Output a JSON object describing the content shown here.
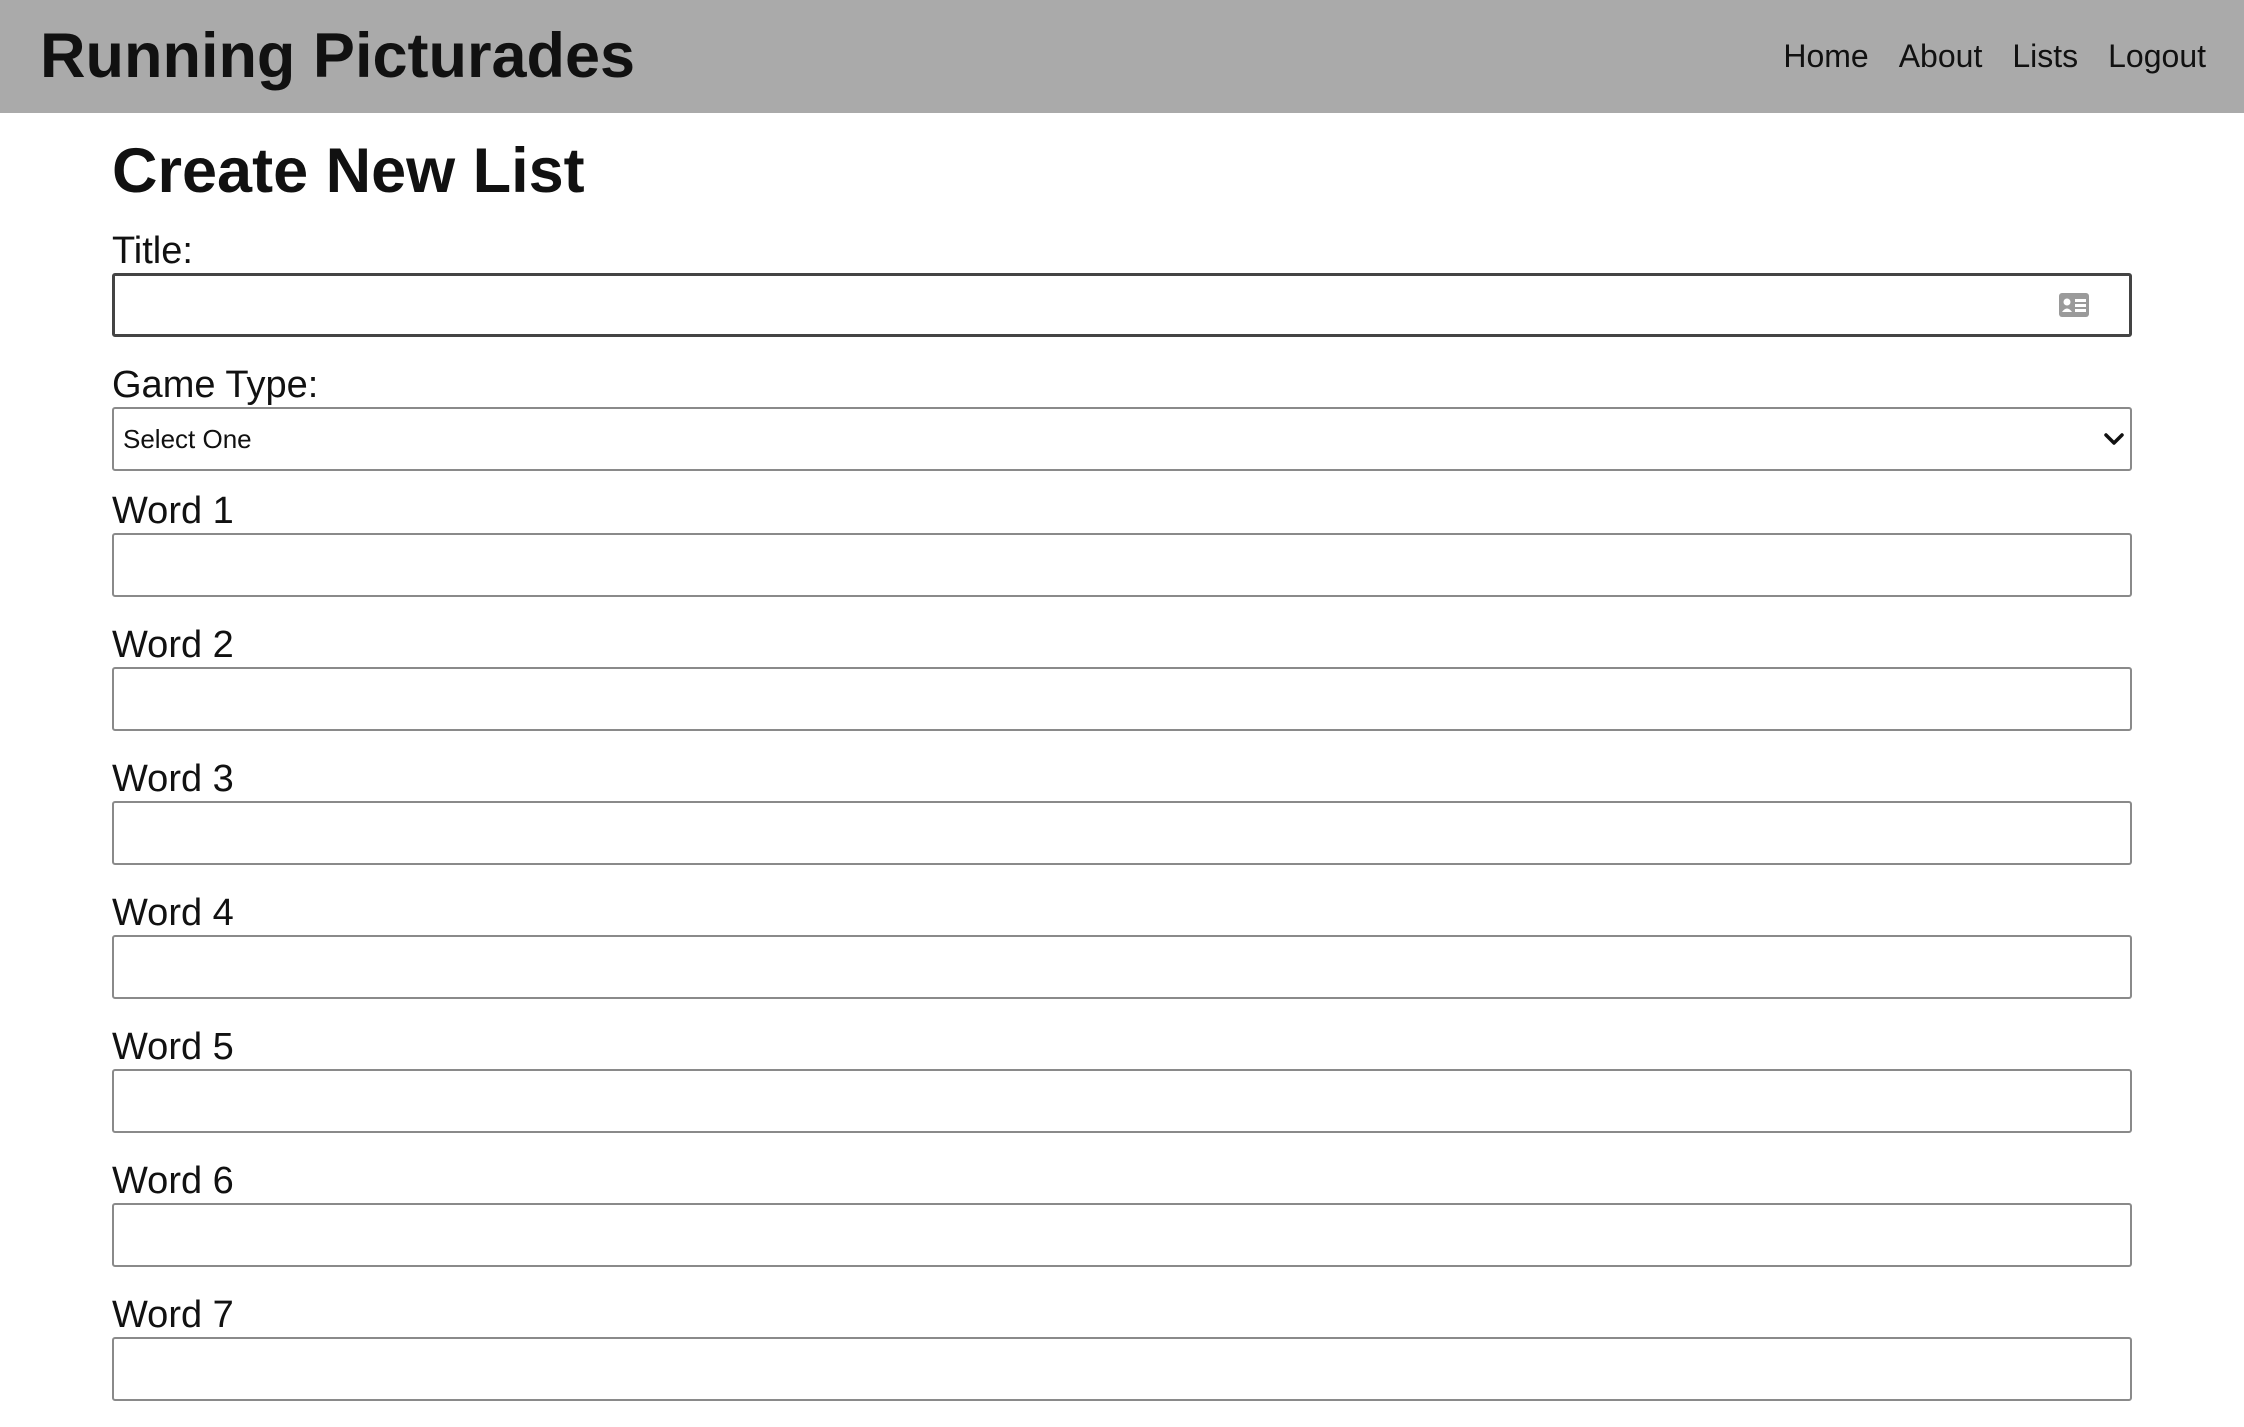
{
  "header": {
    "brand": "Running Picturades",
    "nav": [
      "Home",
      "About",
      "Lists",
      "Logout"
    ]
  },
  "page": {
    "title": "Create New List"
  },
  "form": {
    "title_label": "Title:",
    "title_value": "",
    "game_type_label": "Game Type:",
    "game_type_selected": "Select One",
    "words": [
      {
        "label": "Word 1",
        "value": ""
      },
      {
        "label": "Word 2",
        "value": ""
      },
      {
        "label": "Word 3",
        "value": ""
      },
      {
        "label": "Word 4",
        "value": ""
      },
      {
        "label": "Word 5",
        "value": ""
      },
      {
        "label": "Word 6",
        "value": ""
      },
      {
        "label": "Word 7",
        "value": ""
      }
    ]
  },
  "icons": {
    "title_field_icon": "contact-card-icon",
    "select_icon": "chevron-down-icon"
  }
}
